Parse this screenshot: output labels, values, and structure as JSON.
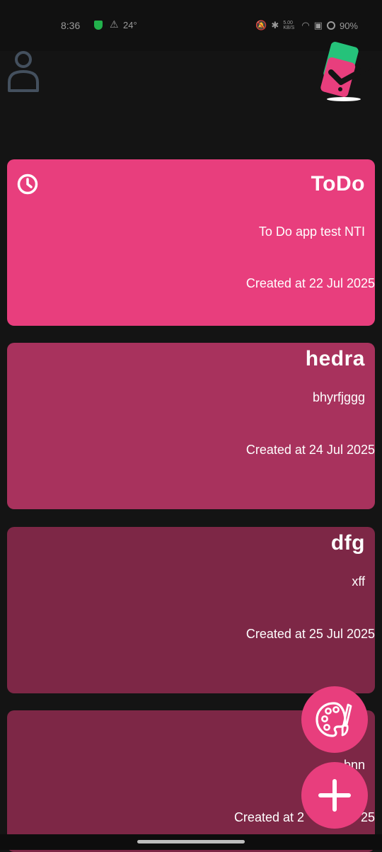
{
  "status_bar": {
    "time": "8:36",
    "temperature": "24°",
    "network_speed": "5.00 KB/S",
    "battery": "90%"
  },
  "notes": [
    {
      "title": "ToDo",
      "description": "To Do app test NTI",
      "date": "Created at 22 Jul 2025",
      "color": "#e83e7d",
      "has_clock": true
    },
    {
      "title": "hedra",
      "description": "bhyrfjggg",
      "date": "Created at 24 Jul 2025",
      "color": "#a8325d"
    },
    {
      "title": "dfg",
      "description": "xff",
      "date": "Created at 25 Jul 2025",
      "color": "#7d2746"
    },
    {
      "title": "",
      "description": "bnn",
      "date": "Created at 2",
      "date_tail": "25",
      "color": "#7d2746"
    }
  ],
  "colors": {
    "accent": "#e83e7d",
    "background": "#141414"
  },
  "icons": {
    "profile": "person-outline-icon",
    "logo": "phone-check-logo",
    "theme": "palette-icon",
    "add": "plus-icon",
    "clock": "clock-icon"
  }
}
